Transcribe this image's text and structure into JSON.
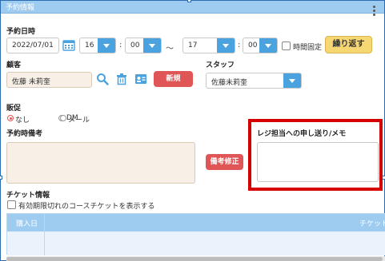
{
  "window": {
    "title": "予約情報"
  },
  "reservation": {
    "section_label": "予約日時",
    "date": "2022/07/01",
    "start_hour": "16",
    "start_minute": "00",
    "tilde": "～",
    "end_hour": "17",
    "end_minute": "00",
    "colon": ":",
    "fixed_time_label": "時間固定",
    "repeat_button": "繰り返す"
  },
  "customer": {
    "label": "顧客",
    "name": "佐藤 未莉奎",
    "new_button": "新規"
  },
  "staff": {
    "label": "スタッフ",
    "selected": "佐藤未莉奎"
  },
  "promo": {
    "label": "販促",
    "options": [
      "なし",
      "DM",
      "メール"
    ],
    "selected": "なし"
  },
  "remarks": {
    "label": "予約時備考",
    "edit_button": "備考修正"
  },
  "memo": {
    "label": "レジ担当への申し送り/メモ"
  },
  "ticket": {
    "label": "チケット情報",
    "show_expired_label": "有効期限切れのコースチケットを表示する",
    "columns": [
      "購入日",
      "チケット"
    ]
  },
  "colors": {
    "accent_blue": "#4aa3df",
    "header_blue": "#9ecbf0",
    "red": "#e05555",
    "yellow": "#f7d774",
    "highlight": "#d60000"
  }
}
